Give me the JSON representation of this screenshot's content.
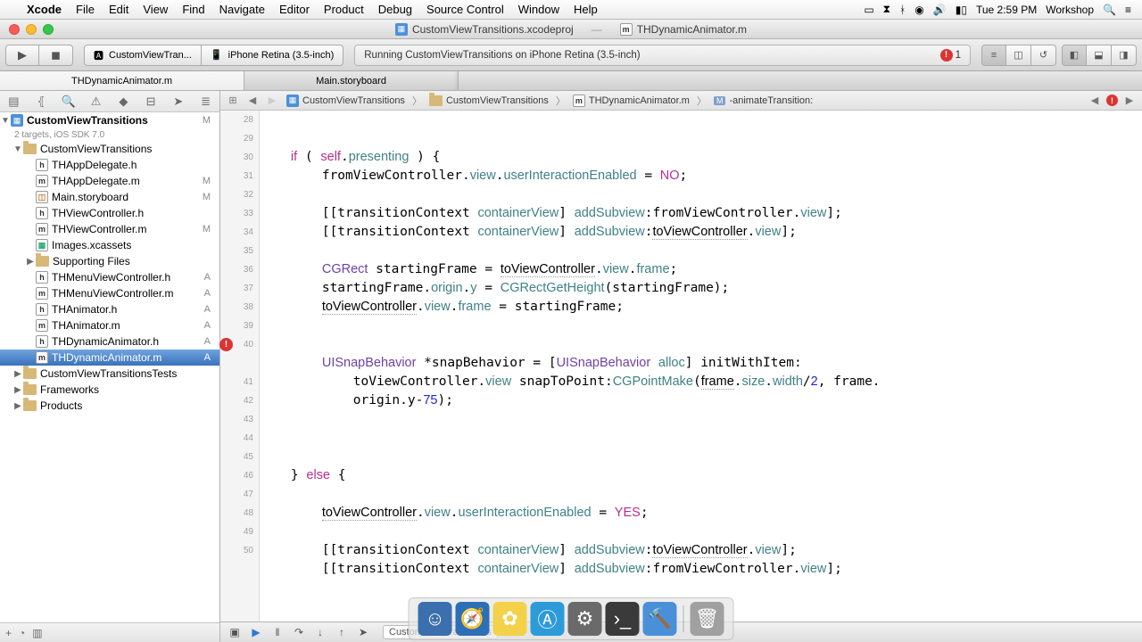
{
  "menubar": {
    "app": "Xcode",
    "items": [
      "File",
      "Edit",
      "View",
      "Find",
      "Navigate",
      "Editor",
      "Product",
      "Debug",
      "Source Control",
      "Window",
      "Help"
    ],
    "right_time": "Tue 2:59 PM",
    "right_user": "Workshop"
  },
  "window": {
    "project": "CustomViewTransitions.xcodeproj",
    "file": "THDynamicAnimator.m"
  },
  "toolbar": {
    "scheme_app": "CustomViewTran...",
    "scheme_device": "iPhone Retina (3.5-inch)",
    "status": "Running CustomViewTransitions on iPhone Retina (3.5-inch)",
    "error_count": "1"
  },
  "tabs": [
    "THDynamicAnimator.m",
    "Main.storyboard"
  ],
  "navigator": {
    "project": {
      "name": "CustomViewTransitions",
      "subtitle": "2 targets, iOS SDK 7.0",
      "status": "M"
    },
    "items": [
      {
        "indent": 1,
        "name": "CustomViewTransitions",
        "icon": "folder",
        "expanded": true
      },
      {
        "indent": 2,
        "name": "THAppDelegate.h",
        "icon": "h"
      },
      {
        "indent": 2,
        "name": "THAppDelegate.m",
        "icon": "m",
        "status": "M"
      },
      {
        "indent": 2,
        "name": "Main.storyboard",
        "icon": "sb",
        "status": "M"
      },
      {
        "indent": 2,
        "name": "THViewController.h",
        "icon": "h"
      },
      {
        "indent": 2,
        "name": "THViewController.m",
        "icon": "m",
        "status": "M"
      },
      {
        "indent": 2,
        "name": "Images.xcassets",
        "icon": "assets"
      },
      {
        "indent": 2,
        "name": "Supporting Files",
        "icon": "folder",
        "expandable": true
      },
      {
        "indent": 2,
        "name": "THMenuViewController.h",
        "icon": "h",
        "status": "A"
      },
      {
        "indent": 2,
        "name": "THMenuViewController.m",
        "icon": "m",
        "status": "A"
      },
      {
        "indent": 2,
        "name": "THAnimator.h",
        "icon": "h",
        "status": "A"
      },
      {
        "indent": 2,
        "name": "THAnimator.m",
        "icon": "m",
        "status": "A"
      },
      {
        "indent": 2,
        "name": "THDynamicAnimator.h",
        "icon": "h",
        "status": "A"
      },
      {
        "indent": 2,
        "name": "THDynamicAnimator.m",
        "icon": "m",
        "status": "A",
        "selected": true
      },
      {
        "indent": 1,
        "name": "CustomViewTransitionsTests",
        "icon": "folder",
        "expandable": true
      },
      {
        "indent": 1,
        "name": "Frameworks",
        "icon": "folder",
        "expandable": true
      },
      {
        "indent": 1,
        "name": "Products",
        "icon": "folder",
        "expandable": true
      }
    ]
  },
  "jumpbar": {
    "segments": [
      "CustomViewTransitions",
      "CustomViewTransitions",
      "THDynamicAnimator.m",
      "-animateTransition:"
    ]
  },
  "gutter_lines": [
    "28",
    "29",
    "30",
    "31",
    "32",
    "33",
    "34",
    "35",
    "36",
    "37",
    "38",
    "39",
    "40",
    "",
    "41",
    "42",
    "43",
    "44",
    "45",
    "46",
    "47",
    "48",
    "49",
    "50"
  ],
  "gutter_error_line_index": 12,
  "code": {
    "l0": "",
    "l1": "    if ( self.presenting ) {",
    "l2": "        fromViewController.view.userInteractionEnabled = NO;",
    "l3": "",
    "l4": "        [[transitionContext containerView] addSubview:fromViewController.view];",
    "l5": "        [[transitionContext containerView] addSubview:toViewController.view];",
    "l6": "",
    "l7": "        CGRect startingFrame = toViewController.view.frame;",
    "l8": "        startingFrame.origin.y = CGRectGetHeight(startingFrame);",
    "l9": "        toViewController.view.frame = startingFrame;",
    "l10": "",
    "l11": "",
    "l12": "        UISnapBehavior *snapBehavior = [UISnapBehavior alloc] initWithItem:",
    "l13": "            toViewController.view snapToPoint:CGPointMake(frame.size.width/2, frame.",
    "l14": "            origin.y-75);",
    "l15": "",
    "l16": "",
    "l17": "",
    "l18": "    } else {",
    "l19": "",
    "l20": "        toViewController.view.userInteractionEnabled = YES;",
    "l21": "",
    "l22": "        [[transitionContext containerView] addSubview:toViewController.view];",
    "l23": "        [[transitionContext containerView] addSubview:fromViewController.view];",
    "l24": ""
  },
  "debugbar": {
    "thread": "CustomViewTransitions"
  }
}
